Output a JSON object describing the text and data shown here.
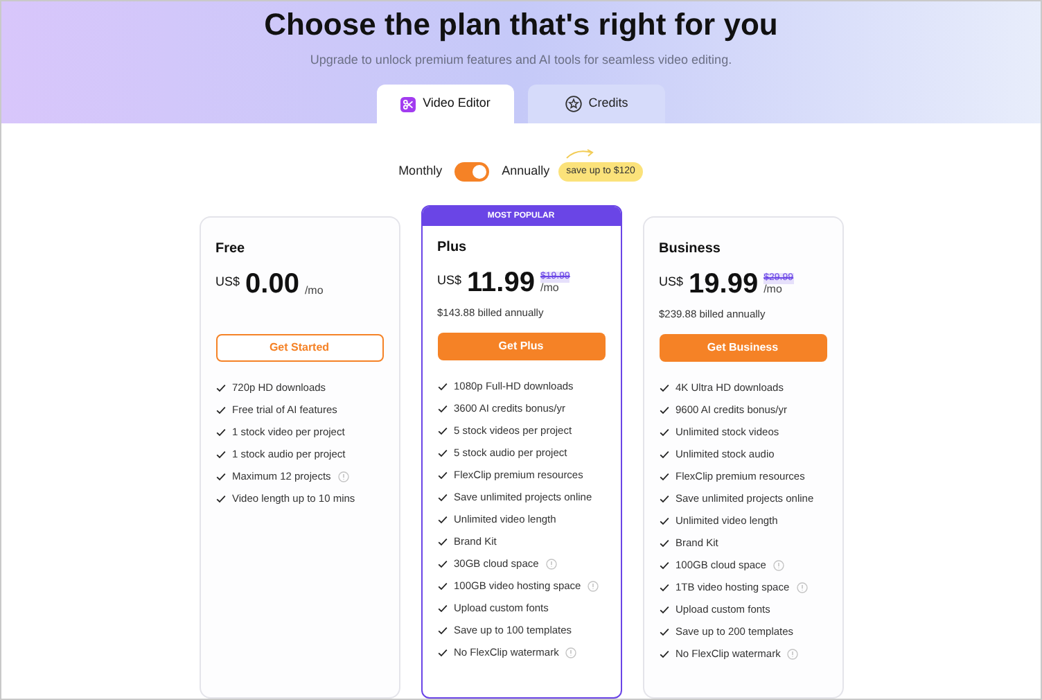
{
  "header": {
    "title": "Choose the plan that's right for you",
    "subtitle": "Upgrade to unlock premium features and AI tools for seamless video editing."
  },
  "tabs": [
    {
      "label": "Video Editor",
      "kind": "editor",
      "selected": true
    },
    {
      "label": "Credits",
      "kind": "credits",
      "selected": false
    }
  ],
  "billing": {
    "monthly_label": "Monthly",
    "annually_label": "Annually",
    "annual": true,
    "badge": "save up to $120"
  },
  "plans": [
    {
      "name": "Free",
      "currency": "US$",
      "price": "0.00",
      "period": "/mo",
      "popular": false,
      "button": "Get Started",
      "button_outlined": true,
      "features": [
        {
          "text": "720p HD downloads",
          "info": false
        },
        {
          "text": "Free trial of AI features",
          "info": false
        },
        {
          "text": "1 stock video per project",
          "info": false
        },
        {
          "text": "1 stock audio per project",
          "info": false
        },
        {
          "text": "Maximum 12 projects",
          "info": true
        },
        {
          "text": "Video length up to 10 mins",
          "info": false
        }
      ]
    },
    {
      "name": "Plus",
      "banner": "MOST POPULAR",
      "currency": "US$",
      "price": "11.99",
      "old_price": "$19.99",
      "period": "/mo",
      "billed": "$143.88 billed annually",
      "popular": true,
      "button": "Get Plus",
      "button_outlined": false,
      "features": [
        {
          "text": "1080p Full-HD downloads",
          "info": false
        },
        {
          "text": "3600 AI credits bonus/yr",
          "info": false
        },
        {
          "text": "5 stock videos per project",
          "info": false
        },
        {
          "text": "5 stock audio per project",
          "info": false
        },
        {
          "text": "FlexClip premium resources",
          "info": false
        },
        {
          "text": "Save unlimited projects online",
          "info": false
        },
        {
          "text": "Unlimited video length",
          "info": false
        },
        {
          "text": "Brand Kit",
          "info": false
        },
        {
          "text": "30GB cloud space",
          "info": true
        },
        {
          "text": "100GB video hosting space",
          "info": true
        },
        {
          "text": "Upload custom fonts",
          "info": false
        },
        {
          "text": "Save up to 100 templates",
          "info": false
        },
        {
          "text": "No FlexClip watermark",
          "info": true
        }
      ]
    },
    {
      "name": "Business",
      "currency": "US$",
      "price": "19.99",
      "old_price": "$29.99",
      "period": "/mo",
      "billed": "$239.88 billed annually",
      "popular": false,
      "button": "Get Business",
      "button_outlined": false,
      "features": [
        {
          "text": "4K Ultra HD downloads",
          "info": false
        },
        {
          "text": "9600 AI credits bonus/yr",
          "info": false
        },
        {
          "text": "Unlimited stock videos",
          "info": false
        },
        {
          "text": "Unlimited stock audio",
          "info": false
        },
        {
          "text": "FlexClip premium resources",
          "info": false
        },
        {
          "text": "Save unlimited projects online",
          "info": false
        },
        {
          "text": "Unlimited video length",
          "info": false
        },
        {
          "text": "Brand Kit",
          "info": false
        },
        {
          "text": "100GB cloud space",
          "info": true
        },
        {
          "text": "1TB video hosting space",
          "info": true
        },
        {
          "text": "Upload custom fonts",
          "info": false
        },
        {
          "text": "Save up to 200 templates",
          "info": false
        },
        {
          "text": "No FlexClip watermark",
          "info": true
        }
      ]
    }
  ]
}
